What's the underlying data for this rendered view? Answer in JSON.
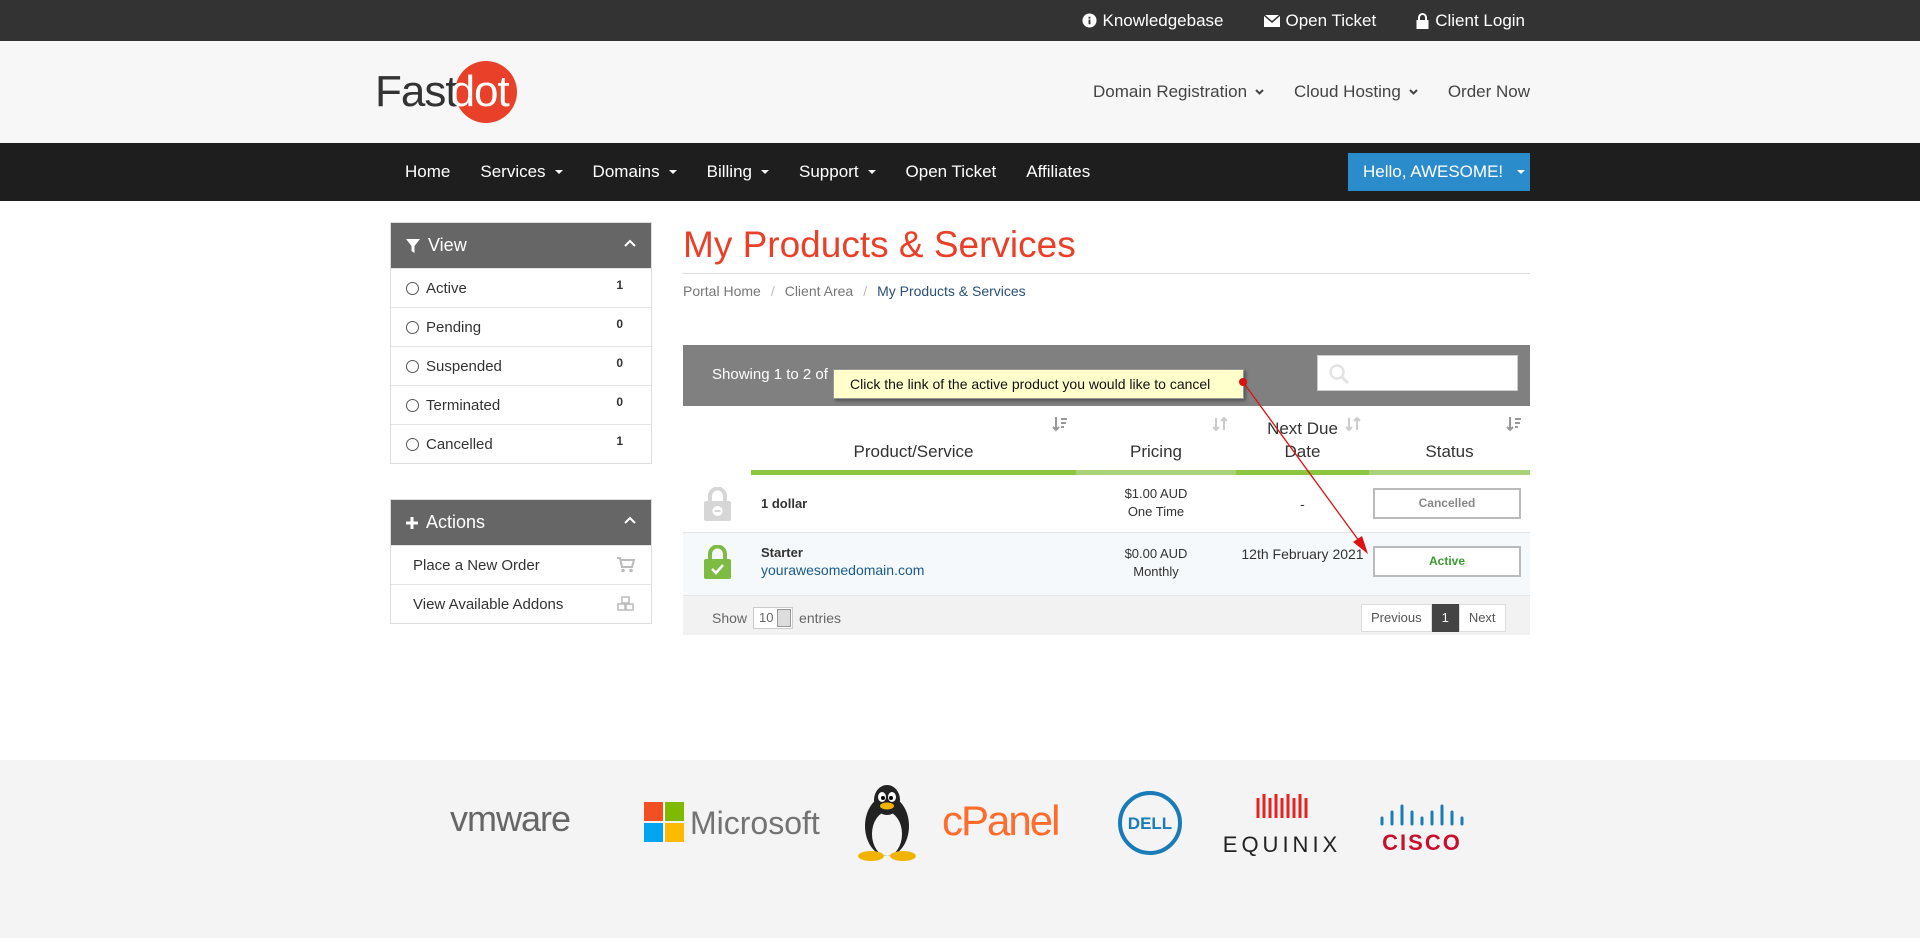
{
  "topbar": {
    "links": [
      {
        "label": "Knowledgebase",
        "icon": "info-circle-icon"
      },
      {
        "label": "Open Ticket",
        "icon": "envelope-icon"
      },
      {
        "label": "Client Login",
        "icon": "lock-icon"
      }
    ]
  },
  "brand": {
    "part1": "Fast",
    "part2": "dot",
    "accent": "#e9402a"
  },
  "header_nav": [
    "Domain Registration",
    "Cloud Hosting",
    "Order Now"
  ],
  "main_nav": {
    "items": [
      "Home",
      "Services",
      "Domains",
      "Billing",
      "Support",
      "Open Ticket",
      "Affiliates"
    ],
    "user": "Hello, AWESOME!"
  },
  "sidebar": {
    "view": {
      "title": "View",
      "items": [
        {
          "label": "Active",
          "count": "1"
        },
        {
          "label": "Pending",
          "count": "0"
        },
        {
          "label": "Suspended",
          "count": "0"
        },
        {
          "label": "Terminated",
          "count": "0"
        },
        {
          "label": "Cancelled",
          "count": "1"
        }
      ]
    },
    "actions": {
      "title": "Actions",
      "items": [
        {
          "label": "Place a New Order",
          "icon": "cart-icon"
        },
        {
          "label": "View Available Addons",
          "icon": "cubes-icon"
        }
      ]
    }
  },
  "page": {
    "title": "My Products & Services",
    "breadcrumb": [
      "Portal Home",
      "Client Area",
      "My Products & Services"
    ]
  },
  "table": {
    "showing": "Showing 1 to 2 of",
    "columns": [
      "Product/Service",
      "Pricing",
      "Next Due Date",
      "Status"
    ],
    "column_colors": [
      "#8dc63f",
      "#a9d37a",
      "#8dc63f",
      "#a9d37a"
    ],
    "rows": [
      {
        "name": "1 dollar",
        "domain": "",
        "price": "$1.00 AUD",
        "cycle": "One Time",
        "due": "-",
        "status": "Cancelled",
        "status_color": "#888888",
        "lock": "grey"
      },
      {
        "name": "Starter",
        "domain": "yourawesomedomain.com",
        "price": "$0.00 AUD",
        "cycle": "Monthly",
        "due": "12th February 2021",
        "status": "Active",
        "status_color": "#3c9a2f",
        "lock": "green"
      }
    ],
    "footer": {
      "show": "Show",
      "entries_value": "10",
      "entries": "entries",
      "prev": "Previous",
      "page": "1",
      "next": "Next"
    }
  },
  "tooltip": "Click the link of the active product you would like to cancel",
  "footer_logos": [
    "vmware",
    "Microsoft",
    "Linux Tux",
    "cPanel",
    "DELL",
    "EQUINIX",
    "CISCO"
  ]
}
